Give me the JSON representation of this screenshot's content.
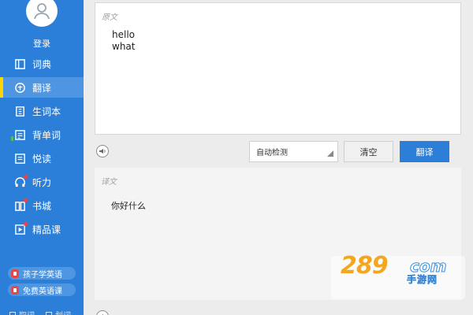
{
  "sidebar": {
    "login_label": "登录",
    "nav": [
      {
        "label": "词典",
        "icon": "book-icon"
      },
      {
        "label": "翻译",
        "icon": "translate-icon"
      },
      {
        "label": "生词本",
        "icon": "notebook-icon"
      },
      {
        "label": "背单词",
        "icon": "flashcard-icon"
      },
      {
        "label": "悦读",
        "icon": "reading-icon"
      },
      {
        "label": "听力",
        "icon": "headphone-icon"
      },
      {
        "label": "书城",
        "icon": "bookstore-icon"
      },
      {
        "label": "精品课",
        "icon": "video-course-icon"
      }
    ],
    "active_index": 1,
    "promos": [
      "孩子学英语",
      "免费英语课"
    ],
    "bottom_links": [
      "取词",
      "划词"
    ]
  },
  "source": {
    "label": "原文",
    "text": "hello\nwhat"
  },
  "toolbar": {
    "language": "自动检测",
    "clear_label": "清空",
    "translate_label": "翻译"
  },
  "result": {
    "label": "译文",
    "text": "你好什么"
  },
  "watermark": {
    "number": "289",
    "com": "com",
    "sub": "手游网"
  },
  "colors": {
    "sidebar": "#2b7fd8",
    "active_item": "#4e96e2",
    "active_marker": "#ffd500",
    "primary_button": "#2b7fd8"
  }
}
